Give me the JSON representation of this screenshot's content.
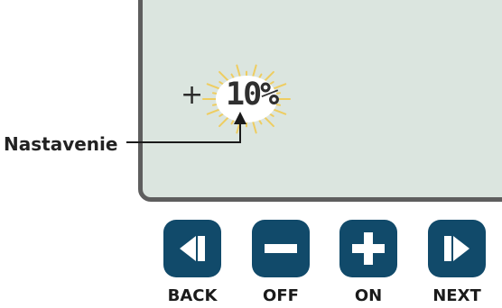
{
  "display": {
    "sign": "+",
    "value": "10%"
  },
  "callout": {
    "label": "Nastavenie"
  },
  "buttons": [
    {
      "label": "BACK",
      "icon": "back-icon"
    },
    {
      "label": "OFF",
      "icon": "minus-icon"
    },
    {
      "label": "ON",
      "icon": "plus-icon"
    },
    {
      "label": "NEXT",
      "icon": "next-icon"
    }
  ],
  "colors": {
    "button": "#114a6a",
    "screen": "#dbe5df",
    "frame": "#5e5e5e"
  }
}
